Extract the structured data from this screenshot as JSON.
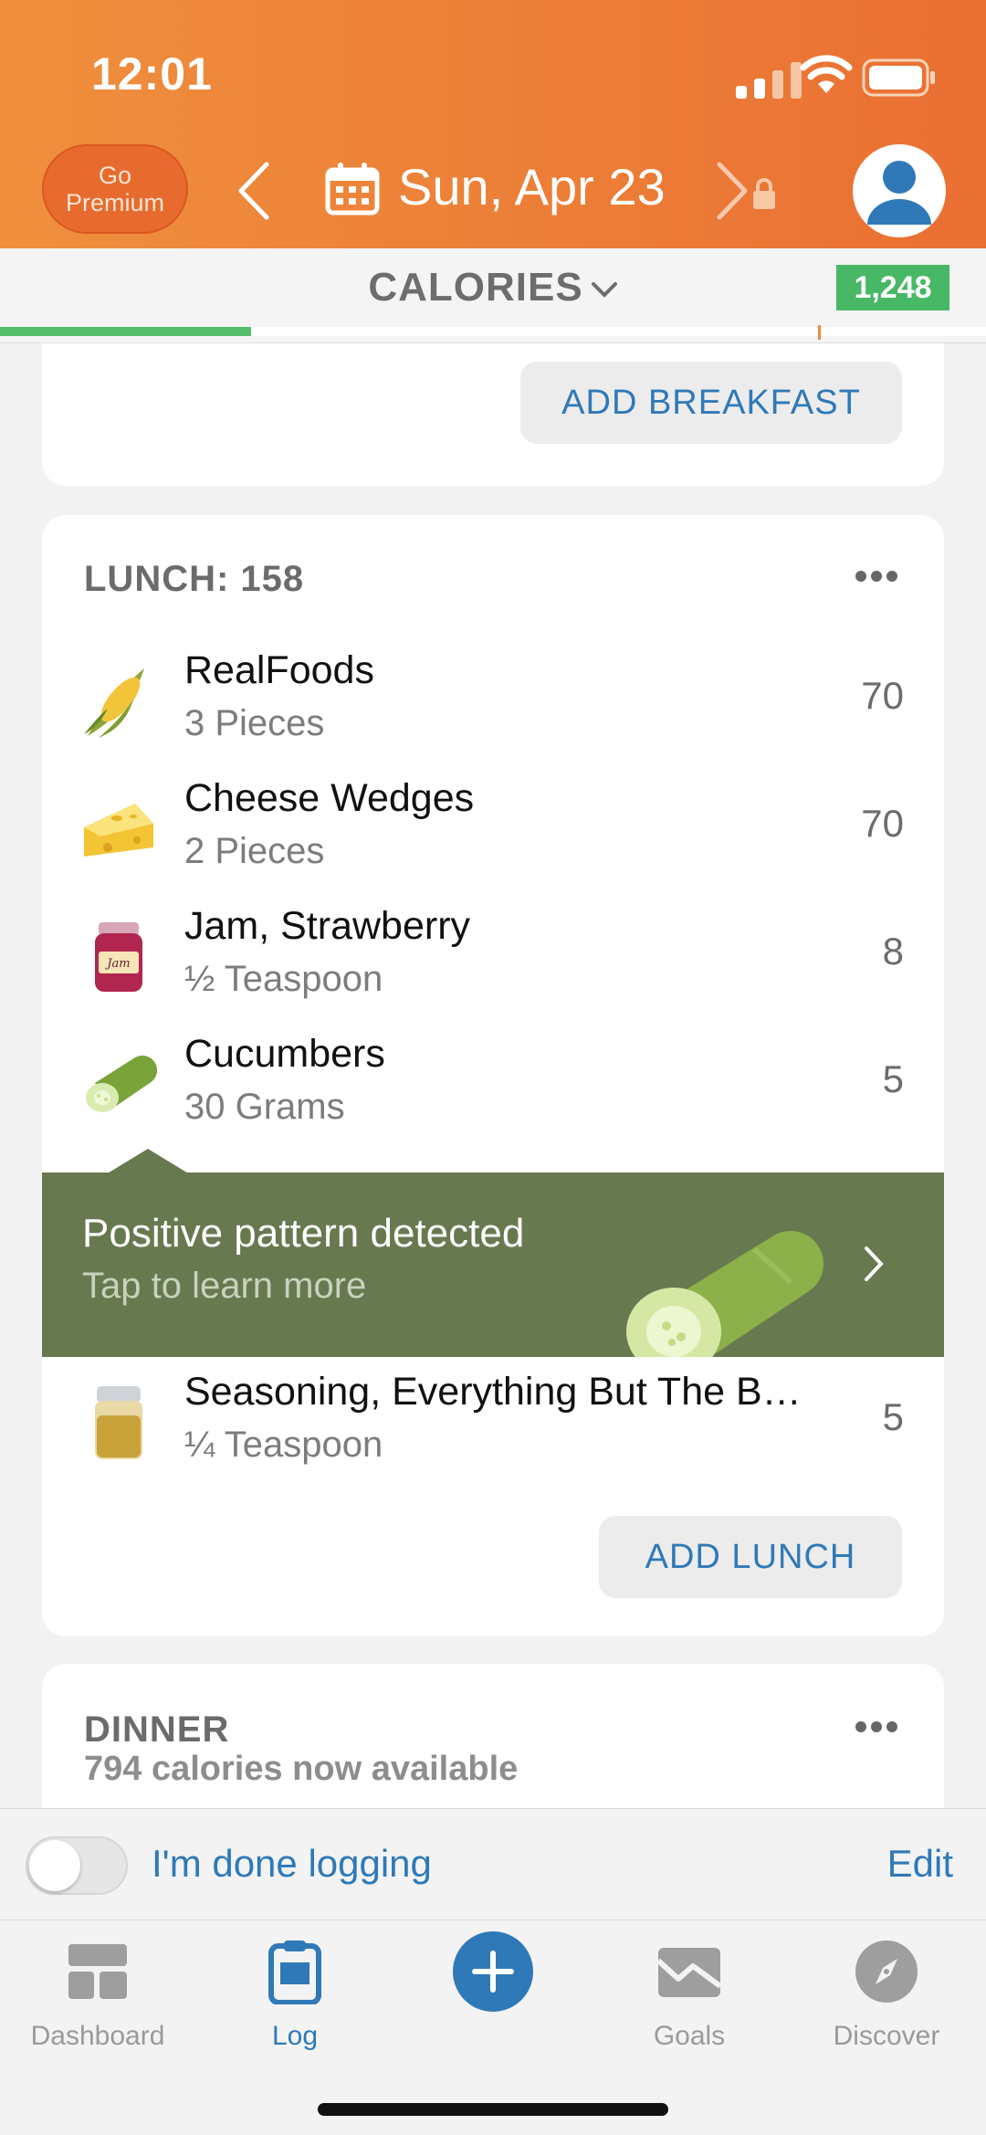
{
  "status_bar": {
    "time": "12:01"
  },
  "header": {
    "go_premium": "Go\nPremium",
    "date": "Sun, Apr 23"
  },
  "calories_bar": {
    "title": "CALORIES",
    "remaining": "1,248",
    "progress_fraction": 0.255,
    "accent_green": "#54be6a"
  },
  "breakfast": {
    "add_button": "ADD BREAKFAST"
  },
  "lunch": {
    "header": "LUNCH: 158",
    "items": [
      {
        "name": "RealFoods",
        "qty": "3 Pieces",
        "calories": "70",
        "icon": "corn-icon"
      },
      {
        "name": "Cheese Wedges",
        "qty": "2 Pieces",
        "calories": "70",
        "icon": "cheese-icon"
      },
      {
        "name": "Jam, Strawberry",
        "qty": "½ Teaspoon",
        "calories": "8",
        "icon": "jam-jar-icon"
      },
      {
        "name": "Cucumbers",
        "qty": "30 Grams",
        "calories": "5",
        "icon": "cucumber-icon"
      },
      {
        "name": "Seasoning, Everything But The B…",
        "qty": "¼ Teaspoon",
        "calories": "5",
        "icon": "spice-jar-icon"
      }
    ],
    "insight": {
      "title": "Positive pattern detected",
      "subtitle": "Tap to learn more"
    },
    "add_button": "ADD LUNCH"
  },
  "dinner": {
    "header": "DINNER",
    "subtitle": "794 calories now available"
  },
  "done_bar": {
    "label": "I'm done logging",
    "edit": "Edit",
    "toggle_on": false
  },
  "tabs": [
    {
      "label": "Dashboard",
      "active": false
    },
    {
      "label": "Log",
      "active": true
    },
    {
      "label": "Goals",
      "active": false
    },
    {
      "label": "Discover",
      "active": false
    }
  ],
  "colors": {
    "header_orange": "#ec7d37",
    "link_blue": "#2f79b8",
    "insight_green": "#67794e"
  }
}
